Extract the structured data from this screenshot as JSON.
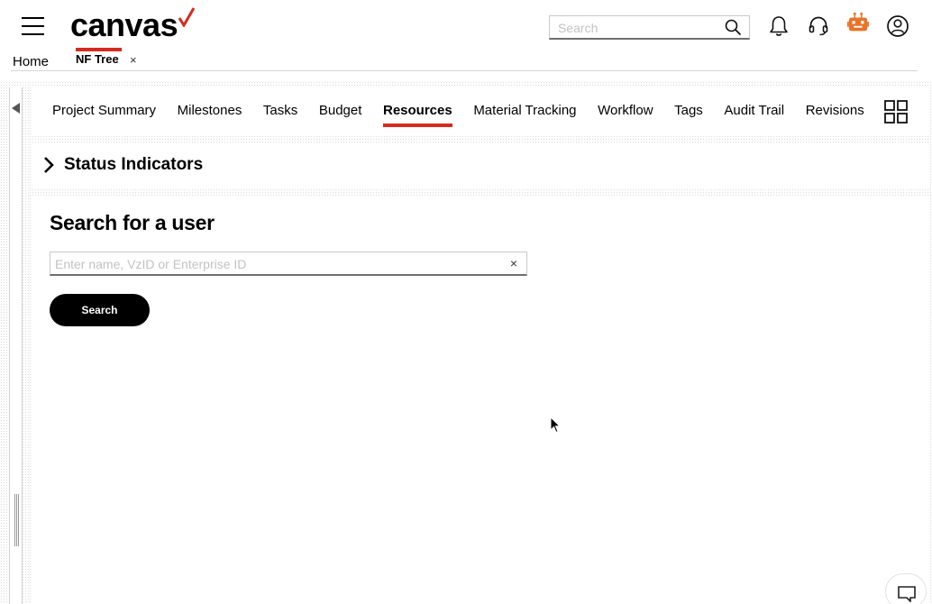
{
  "header": {
    "logo_text": "canvas",
    "brand_color": "#d52b1e",
    "search_placeholder": "Search",
    "icons": [
      "menu-icon",
      "search-icon",
      "bell-icon",
      "headset-icon",
      "bot-icon",
      "account-icon"
    ]
  },
  "tabs": {
    "home_label": "Home",
    "open_tab_label": "NF Tree",
    "close_glyph": "×"
  },
  "section_nav": {
    "items": [
      {
        "label": "Project Summary",
        "active": false
      },
      {
        "label": "Milestones",
        "active": false
      },
      {
        "label": "Tasks",
        "active": false
      },
      {
        "label": "Budget",
        "active": false
      },
      {
        "label": "Resources",
        "active": true
      },
      {
        "label": "Material Tracking",
        "active": false
      },
      {
        "label": "Workflow",
        "active": false
      },
      {
        "label": "Tags",
        "active": false
      },
      {
        "label": "Audit Trail",
        "active": false
      },
      {
        "label": "Revisions",
        "active": false
      }
    ]
  },
  "status_indicators": {
    "label": "Status Indicators",
    "expanded": false
  },
  "user_search": {
    "title": "Search for a user",
    "placeholder": "Enter name, VzID or Enterprise ID",
    "value": "",
    "clear_glyph": "×",
    "button_label": "Search"
  }
}
